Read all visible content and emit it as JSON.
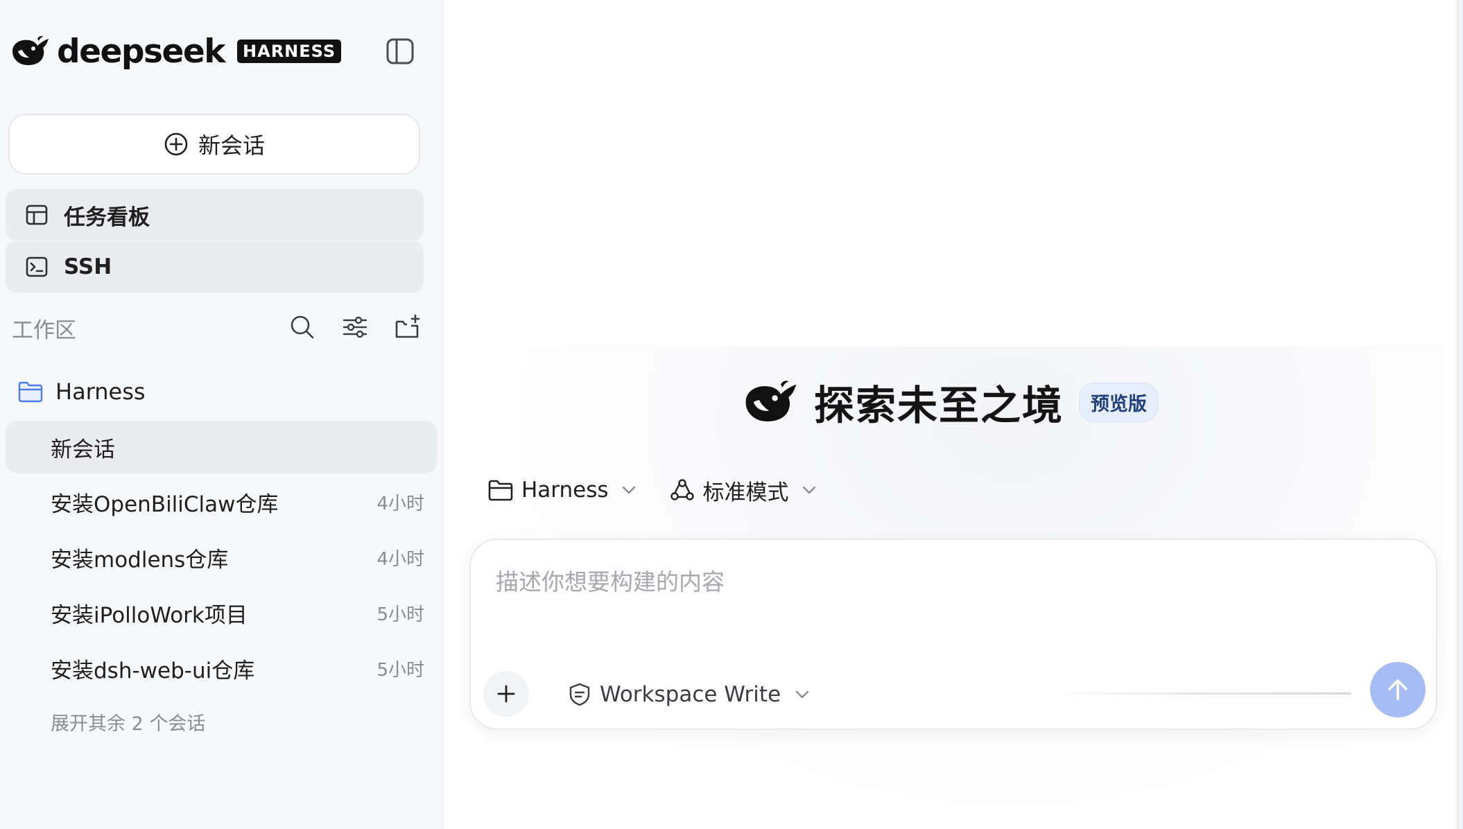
{
  "brand": {
    "name": "deepseek",
    "tag": "HARNESS",
    "logo_icon": "whale-icon"
  },
  "sidebar": {
    "new_chat_label": "新会话",
    "nav": [
      {
        "label": "任务看板",
        "icon": "kanban-icon"
      },
      {
        "label": "SSH",
        "icon": "terminal-icon"
      }
    ],
    "workspace_label": "工作区",
    "workspace_tools": [
      "search-icon",
      "filter-icon",
      "new-folder-icon"
    ],
    "folder": {
      "name": "Harness",
      "icon": "folder-icon"
    },
    "sessions": [
      {
        "title": "新会话",
        "time": "",
        "active": true
      },
      {
        "title": "安装OpenBiliClaw仓库",
        "time": "4小时"
      },
      {
        "title": "安装modlens仓库",
        "time": "4小时"
      },
      {
        "title": "安装iPolloWork项目",
        "time": "5小时"
      },
      {
        "title": "安装dsh-web-ui仓库",
        "time": "5小时"
      }
    ],
    "expand_label": "展开其余 2 个会话"
  },
  "main": {
    "hero_title": "探索未至之境",
    "hero_badge": "预览版",
    "project_selector": "Harness",
    "mode_selector": "标准模式",
    "composer": {
      "placeholder": "描述你想要构建的内容",
      "value": "",
      "permission_label": "Workspace Write"
    }
  },
  "colors": {
    "sidebar_bg": "#f7f8fa",
    "active_bg": "#ebecef",
    "folder_icon": "#4a7cf0",
    "badge_bg": "#e6eefb",
    "badge_text": "#22407a",
    "send_button": "#a5bdf2"
  }
}
